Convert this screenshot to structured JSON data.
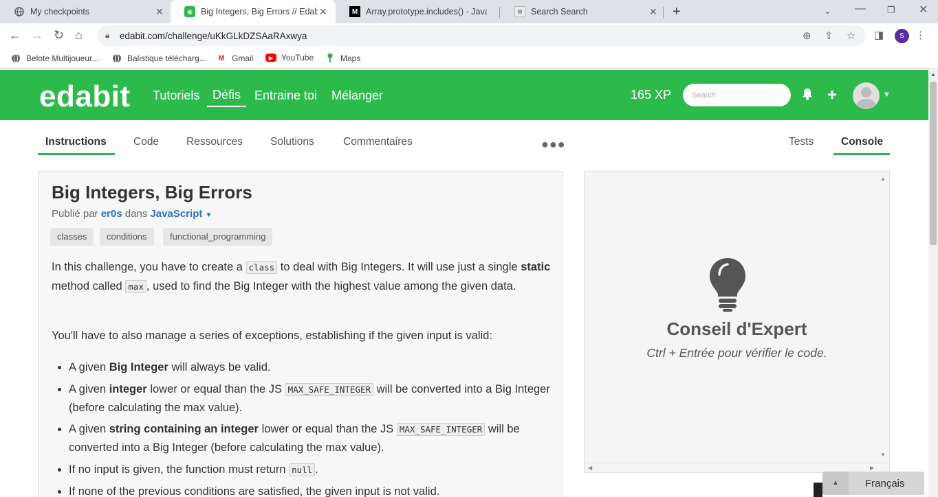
{
  "browser": {
    "tabs": [
      {
        "title": "My checkpoints",
        "icon": "globe-icon",
        "active": false
      },
      {
        "title": "Big Integers, Big Errors // Edabit",
        "icon": "edabit-icon",
        "active": true
      },
      {
        "title": "Array.prototype.includes() - JavaS",
        "icon": "mdn-icon",
        "active": false
      },
      {
        "title": "Search Search",
        "icon": "search-favicon",
        "active": false
      }
    ],
    "url": "edabit.com/challenge/uKkGLkDZSAaRAxwya",
    "profile_initial": "S",
    "bookmarks": [
      {
        "label": "Belote Multijoueur...",
        "icon": "globe-icon"
      },
      {
        "label": "Balistique télécharg...",
        "icon": "globe-icon"
      },
      {
        "label": "Gmail",
        "icon": "gmail-icon"
      },
      {
        "label": "YouTube",
        "icon": "youtube-icon"
      },
      {
        "label": "Maps",
        "icon": "maps-icon"
      }
    ]
  },
  "site": {
    "logo": "edabit",
    "nav": [
      "Tutoriels",
      "Défis",
      "Entraine toi",
      "Mélanger"
    ],
    "active_nav": "Défis",
    "xp": "165 XP",
    "search_placeholder": "Search",
    "brand_color": "#2cbb4b"
  },
  "subtabs": {
    "left": [
      "Instructions",
      "Code",
      "Ressources",
      "Solutions",
      "Commentaires"
    ],
    "right": [
      "Tests",
      "Console"
    ],
    "active_left": "Instructions",
    "active_right": "Console"
  },
  "challenge": {
    "title": "Big Integers, Big Errors",
    "published_prefix": "Publié par",
    "author": "er0s",
    "in_word": "dans",
    "language": "JavaScript",
    "tags": [
      "classes",
      "conditions",
      "functional_programming"
    ],
    "intro": {
      "t1": "In this challenge, you have to create a ",
      "code1": "class",
      "t2": " to deal with Big Integers. It will use just a single ",
      "bold1": "static",
      "t3": " method called ",
      "code2": "max",
      "t4": ", used to find the Big Integer with the highest value among the given data."
    },
    "para2": "You'll have to also manage a series of exceptions, establishing if the given input is valid:",
    "rules": {
      "r1": {
        "a": "A given ",
        "b": "Big Integer",
        "c": " will always be valid."
      },
      "r2": {
        "a": "A given ",
        "b": "integer",
        "c": " lower or equal than the JS ",
        "code": "MAX_SAFE_INTEGER",
        "d": " will be converted into a Big Integer (before calculating the max value)."
      },
      "r3": {
        "a": "A given ",
        "b": "string containing an integer",
        "c": " lower or equal than the JS ",
        "code": "MAX_SAFE_INTEGER",
        "d": " will be converted into a Big Integer (before calculating the max value)."
      },
      "r4": {
        "a": "If no input is given, the function must return ",
        "code": "null",
        "d": "."
      },
      "r5": {
        "a": "If none of the previous conditions are satisfied, the given input is not valid."
      }
    }
  },
  "console": {
    "tip_title": "Conseil d'Expert",
    "tip_subtitle": "Ctrl + Entrée pour vérifier le code."
  },
  "language_selector": "Français"
}
